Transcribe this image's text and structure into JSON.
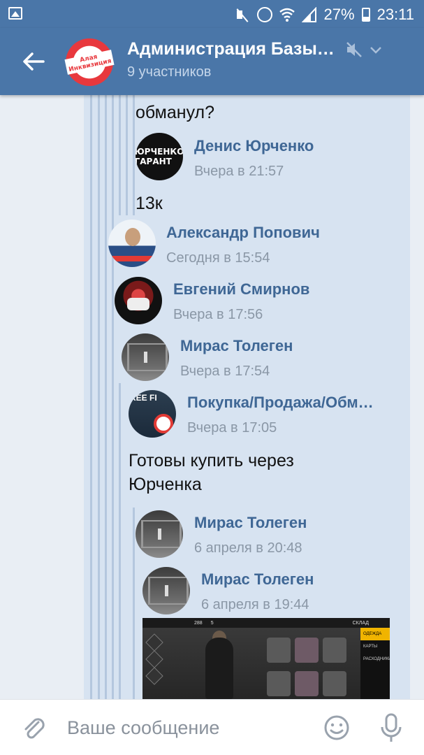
{
  "status_bar": {
    "battery": "27%",
    "time": "23:11",
    "icons": [
      "gallery-icon",
      "mute-icon",
      "alarm-icon",
      "wifi-icon",
      "signal-icon",
      "battery-icon"
    ]
  },
  "header": {
    "title": "Администрация Базы…",
    "subtitle": "9 участников",
    "avatar_text": "Алая Инквизиция",
    "accent_color": "#4a76a8"
  },
  "thread": {
    "top_fragment": "обманул?",
    "messages": [
      {
        "author": "Денис Юрченко",
        "time": "Вчера в 21:57",
        "text": "13к",
        "avatar_text": "ЮРЧЕНКО ГАРАНТ"
      },
      {
        "author": "Александр Попович",
        "time": "Сегодня в 15:54",
        "text": ""
      },
      {
        "author": "Евгений Смирнов",
        "time": "Вчера в 17:56",
        "text": ""
      },
      {
        "author": "Мирас Толеген",
        "time": "Вчера в 17:54",
        "text": ""
      },
      {
        "author": "Покупка/Продажа/Обм…",
        "time": "Вчера в 17:05",
        "text": "Готовы купить через Юрченка"
      },
      {
        "author": "Мирас Толеген",
        "time": "6 апреля в 20:48",
        "text": ""
      },
      {
        "author": "Мирас Толеген",
        "time": "6 апреля в 19:44",
        "text": ""
      }
    ],
    "attachment": {
      "coins": "288",
      "gems": "5",
      "screen_title": "СКЛАД",
      "menu": [
        "ОДЕЖДА",
        "КАРТЫ",
        "РАСХОДНИКИ"
      ]
    }
  },
  "composer": {
    "placeholder": "Ваше сообщение"
  }
}
